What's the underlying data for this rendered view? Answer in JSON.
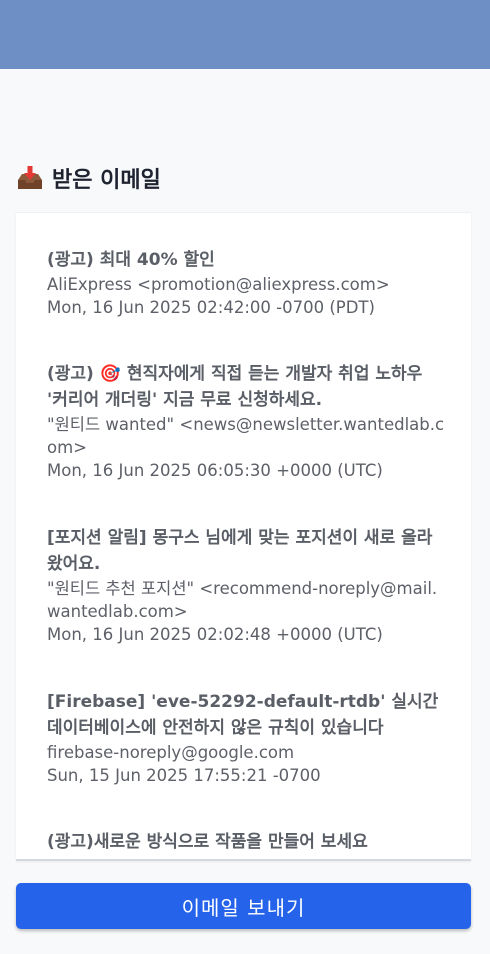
{
  "inbox": {
    "title": "받은 이메일",
    "icon": "inbox-tray-icon",
    "emails": [
      {
        "subject": "(광고) 최대 40% 할인",
        "from": "AliExpress <promotion@aliexpress.com>",
        "date": "Mon, 16 Jun 2025 02:42:00 -0700 (PDT)"
      },
      {
        "subject": "(광고) 🎯 현직자에게 직접 듣는 개발자 취업 노하우 '커리어 개더링' 지금 무료 신청하세요.",
        "from": "\"원티드 wanted\" <news@newsletter.wantedlab.com>",
        "date": "Mon, 16 Jun 2025 06:05:30 +0000 (UTC)"
      },
      {
        "subject": "[포지션 알림] 몽구스 님에게 맞는 포지션이 새로 올라왔어요.",
        "from": "\"원티드 추천 포지션\" <recommend-noreply@mail.wantedlab.com>",
        "date": "Mon, 16 Jun 2025 02:02:48 +0000 (UTC)"
      },
      {
        "subject": "[Firebase] 'eve-52292-default-rtdb' 실시간 데이터베이스에 안전하지 않은 규칙이 있습니다",
        "from": "firebase-noreply@google.com",
        "date": "Sun, 15 Jun 2025 17:55:21 -0700"
      },
      {
        "subject": "(광고)새로운 방식으로 작품을 만들어 보세요",
        "from": "",
        "date": ""
      }
    ]
  },
  "actions": {
    "send_label": "이메일 보내기"
  },
  "colors": {
    "header": "#6e8fc5",
    "primary": "#2563eb"
  }
}
